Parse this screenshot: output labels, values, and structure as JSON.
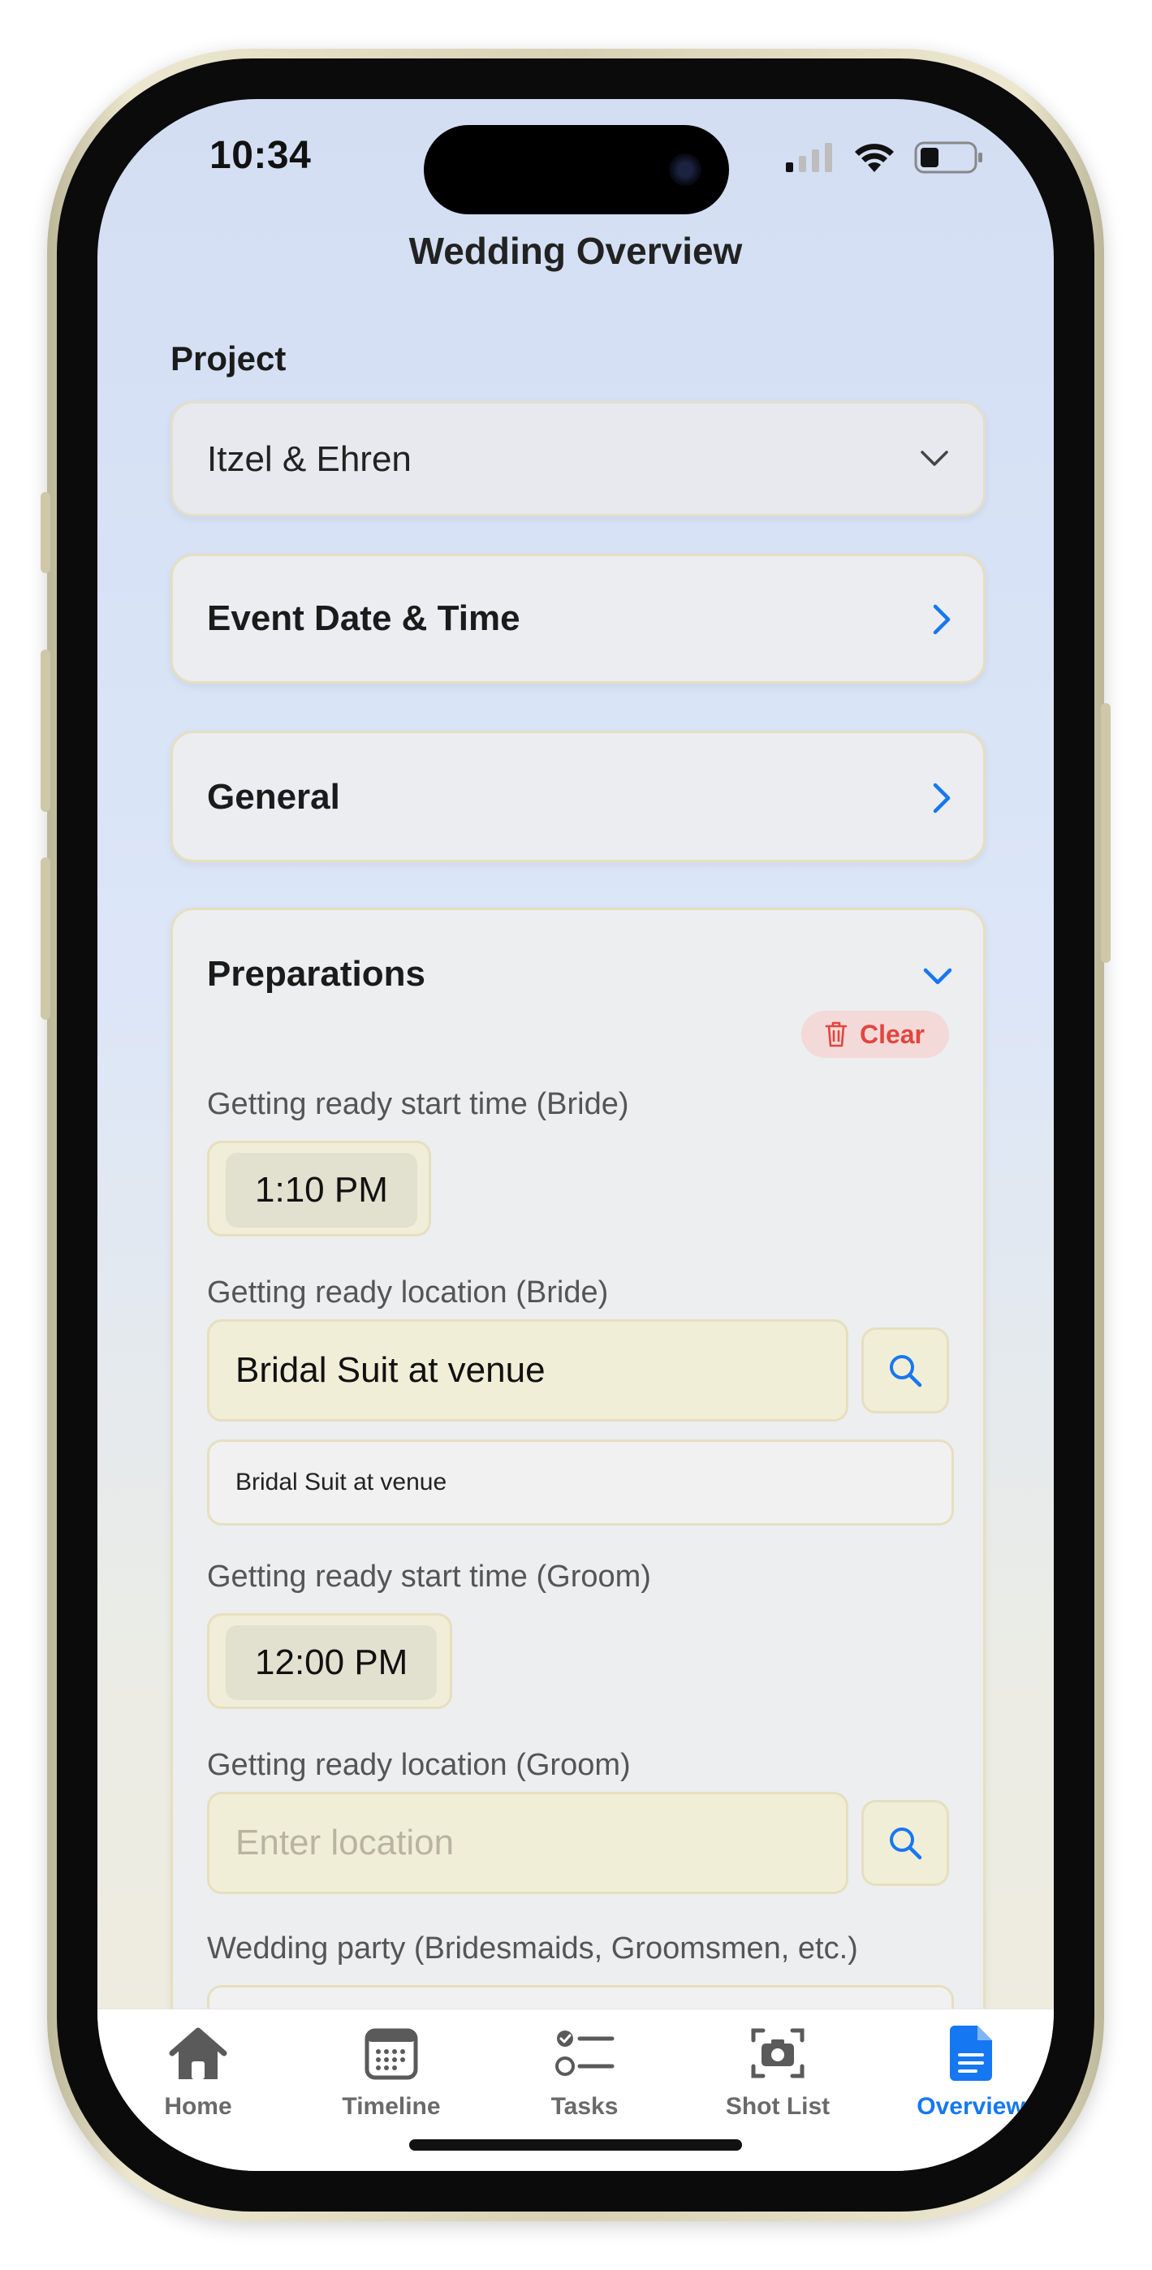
{
  "status_bar": {
    "time": "10:34"
  },
  "header": {
    "title": "Wedding Overview"
  },
  "project": {
    "label": "Project",
    "selected": "Itzel & Ehren"
  },
  "sections": {
    "event": {
      "title": "Event Date & Time"
    },
    "general": {
      "title": "General"
    },
    "preparations": {
      "title": "Preparations",
      "clear_label": "Clear",
      "bride_time_label": "Getting ready start time (Bride)",
      "bride_time": "1:10 PM",
      "bride_location_label": "Getting ready location (Bride)",
      "bride_location": "Bridal Suit at venue",
      "bride_location_display": "Bridal Suit at venue",
      "groom_time_label": "Getting ready start time (Groom)",
      "groom_time": "12:00 PM",
      "groom_location_label": "Getting ready location (Groom)",
      "groom_location_placeholder": "Enter location",
      "party_label": "Wedding party (Bridesmaids, Groomsmen, etc.)"
    }
  },
  "tabs": [
    {
      "label": "Home",
      "icon": "house-icon",
      "active": false
    },
    {
      "label": "Timeline",
      "icon": "calendar-icon",
      "active": false
    },
    {
      "label": "Tasks",
      "icon": "checklist-icon",
      "active": false
    },
    {
      "label": "Shot List",
      "icon": "camera-icon",
      "active": false
    },
    {
      "label": "Overview",
      "icon": "document-icon",
      "active": true
    }
  ],
  "colors": {
    "accent": "#1677f2",
    "danger": "#e2463f",
    "card_border": "#e6dfbf"
  }
}
